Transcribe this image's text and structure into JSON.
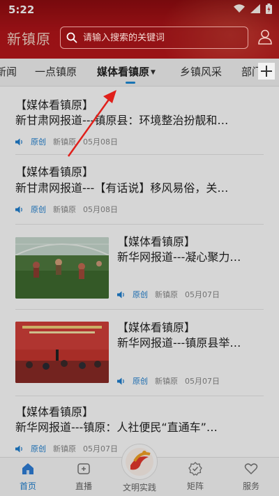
{
  "status_bar": {
    "time": "5:22"
  },
  "header": {
    "brand": "新镇原",
    "search_placeholder": "请输入搜索的关键词"
  },
  "tabs": [
    {
      "label": "新闻"
    },
    {
      "label": "一点镇原"
    },
    {
      "label": "媒体看镇原",
      "active": true
    },
    {
      "label": "乡镇风采"
    },
    {
      "label": "部门"
    }
  ],
  "articles": [
    {
      "line1": "【媒体看镇原】",
      "line2": "新甘肃网报道---镇原县：环境整治扮靓和…",
      "tag": "原创",
      "source": "新镇原",
      "date": "05月08日"
    },
    {
      "line1": "【媒体看镇原】",
      "line2": "新甘肃网报道---【有话说】移风易俗，关…",
      "tag": "原创",
      "source": "新镇原",
      "date": "05月08日"
    },
    {
      "line1": "【媒体看镇原】",
      "line2": "新华网报道---凝心聚力…",
      "tag": "原创",
      "source": "新镇原",
      "date": "05月07日"
    },
    {
      "line1": "【媒体看镇原】",
      "line2": "新华网报道---镇原县举…",
      "tag": "原创",
      "source": "新镇原",
      "date": "05月07日"
    },
    {
      "line1": "【媒体看镇原】",
      "line2": "新华网报道---镇原：人社便民“直通车”…",
      "tag": "原创",
      "source": "新镇原",
      "date": "05月07日"
    }
  ],
  "bottom_nav": [
    {
      "label": "首页",
      "active": true
    },
    {
      "label": "直播"
    },
    {
      "label": "文明实践"
    },
    {
      "label": "矩阵"
    },
    {
      "label": "服务"
    }
  ],
  "colors": {
    "header_red": "#b3151a",
    "accent_blue": "#1e8bd6",
    "annotation_red": "#e0201b"
  }
}
